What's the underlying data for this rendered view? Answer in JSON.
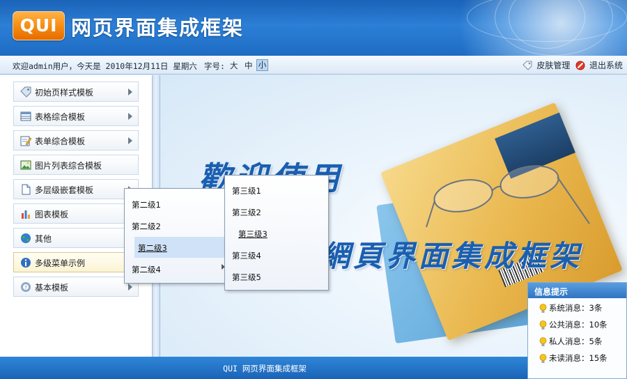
{
  "header": {
    "logo_text": "QUI",
    "title": "网页界面集成框架"
  },
  "toolbar": {
    "welcome": "欢迎admin用户，今天是 2010年12月11日 星期六",
    "font_size_label": "字号:",
    "font_sizes": [
      "大",
      "中",
      "小"
    ],
    "selected_font_size": "小",
    "skin_label": "皮肤管理",
    "logout_label": "退出系统"
  },
  "sidebar": {
    "items": [
      {
        "label": "初始页样式模板",
        "icon": "tag-icon",
        "has_submenu": true
      },
      {
        "label": "表格综合模板",
        "icon": "table-icon",
        "has_submenu": true
      },
      {
        "label": "表单综合模板",
        "icon": "form-edit-icon",
        "has_submenu": true
      },
      {
        "label": "图片列表综合模板",
        "icon": "picture-icon",
        "has_submenu": false
      },
      {
        "label": "多层级嵌套模板",
        "icon": "document-icon",
        "has_submenu": true
      },
      {
        "label": "图表模板",
        "icon": "bar-chart-icon",
        "has_submenu": true
      },
      {
        "label": "其他",
        "icon": "globe-icon",
        "has_submenu": false
      },
      {
        "label": "多级菜单示例",
        "icon": "info-icon",
        "has_submenu": false,
        "active": true
      },
      {
        "label": "基本模板",
        "icon": "help-icon",
        "has_submenu": true
      }
    ]
  },
  "submenu_level2": {
    "items": [
      "第二级1",
      "第二级2",
      "第二级3",
      "第二级4"
    ],
    "highlighted": "第二级3"
  },
  "submenu_level3": {
    "items": [
      "第三级1",
      "第三级2",
      "第三级3",
      "第三级4",
      "第三级5"
    ],
    "hovered": "第三级3"
  },
  "main": {
    "welcome_line1": "歡迎使用",
    "welcome_line2": "網頁界面集成框架"
  },
  "footer": {
    "text": "QUI 网页界面集成框架"
  },
  "info_panel": {
    "title": "信息提示",
    "rows": [
      "系统消息：3条",
      "公共消息：10条",
      "私人消息：5条",
      "未读消息：15条"
    ]
  },
  "colors": {
    "header_blue": "#1a63b8",
    "logo_orange": "#f58a10",
    "highlight": "#cfe2f7",
    "title_text": "#1a5fb0"
  }
}
